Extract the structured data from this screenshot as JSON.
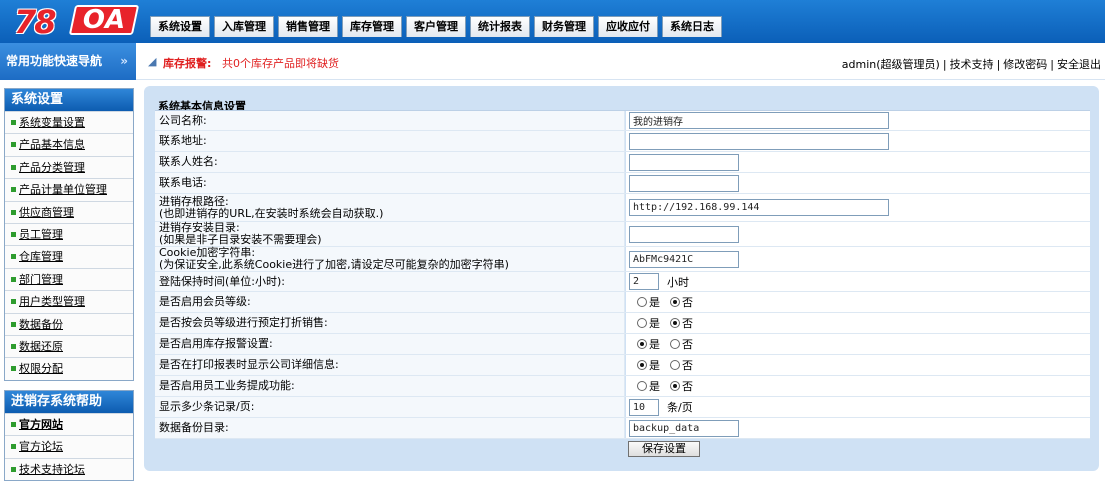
{
  "logo": {
    "num": "78",
    "oa": "OA"
  },
  "menu": [
    "系统设置",
    "入库管理",
    "销售管理",
    "库存管理",
    "客户管理",
    "统计报表",
    "财务管理",
    "应收应付",
    "系统日志"
  ],
  "quicknav": {
    "title": "常用功能快速导航",
    "chevron": "»"
  },
  "alert": {
    "label": "库存报警:",
    "text": "共0个库存产品即将缺货"
  },
  "user": {
    "name": "admin(超级管理员)",
    "links": [
      "技术支持",
      "修改密码",
      "安全退出"
    ],
    "separator": "|"
  },
  "sidebar": {
    "system": {
      "title": "系统设置",
      "items": [
        "系统变量设置",
        "产品基本信息",
        "产品分类管理",
        "产品计量单位管理",
        "供应商管理",
        "员工管理",
        "仓库管理",
        "部门管理",
        "用户类型管理",
        "数据备份",
        "数据还原",
        "权限分配"
      ]
    },
    "help": {
      "title": "进销存系统帮助",
      "items": [
        "官方网站",
        "官方论坛",
        "技术支持论坛"
      ]
    }
  },
  "form": {
    "title": "系统基本信息设置",
    "company_name": {
      "label": "公司名称:",
      "value": "我的进销存"
    },
    "address": {
      "label": "联系地址:",
      "value": ""
    },
    "contact": {
      "label": "联系人姓名:",
      "value": ""
    },
    "phone": {
      "label": "联系电话:",
      "value": ""
    },
    "root_path": {
      "label": "进销存根路径:",
      "hint": "(也即进销存的URL,在安装时系统会自动获取.)",
      "value": "http://192.168.99.144"
    },
    "install_dir": {
      "label": "进销存安装目录:",
      "hint": "(如果是非子目录安装不需要理会)",
      "value": ""
    },
    "cookie_key": {
      "label": "Cookie加密字符串:",
      "hint": "(为保证安全,此系统Cookie进行了加密,请设定尽可能复杂的加密字符串)",
      "value": "AbFMc9421C"
    },
    "login_hours": {
      "label": "登陆保持时间(单位:小时):",
      "value": "2",
      "unit": "小时"
    },
    "yes": "是",
    "no": "否",
    "member_level": {
      "label": "是否启用会员等级:",
      "selected": "no"
    },
    "member_discount": {
      "label": "是否按会员等级进行预定打折销售:",
      "selected": "no"
    },
    "stock_alarm": {
      "label": "是否启用库存报警设置:",
      "selected": "yes"
    },
    "print_company": {
      "label": "是否在打印报表时显示公司详细信息:",
      "selected": "yes"
    },
    "commission": {
      "label": "是否启用员工业务提成功能:",
      "selected": "no"
    },
    "page_size": {
      "label": "显示多少条记录/页:",
      "value": "10",
      "unit": "条/页"
    },
    "backup_dir": {
      "label": "数据备份目录:",
      "value": "backup_data"
    },
    "save_label": "保存设置"
  }
}
